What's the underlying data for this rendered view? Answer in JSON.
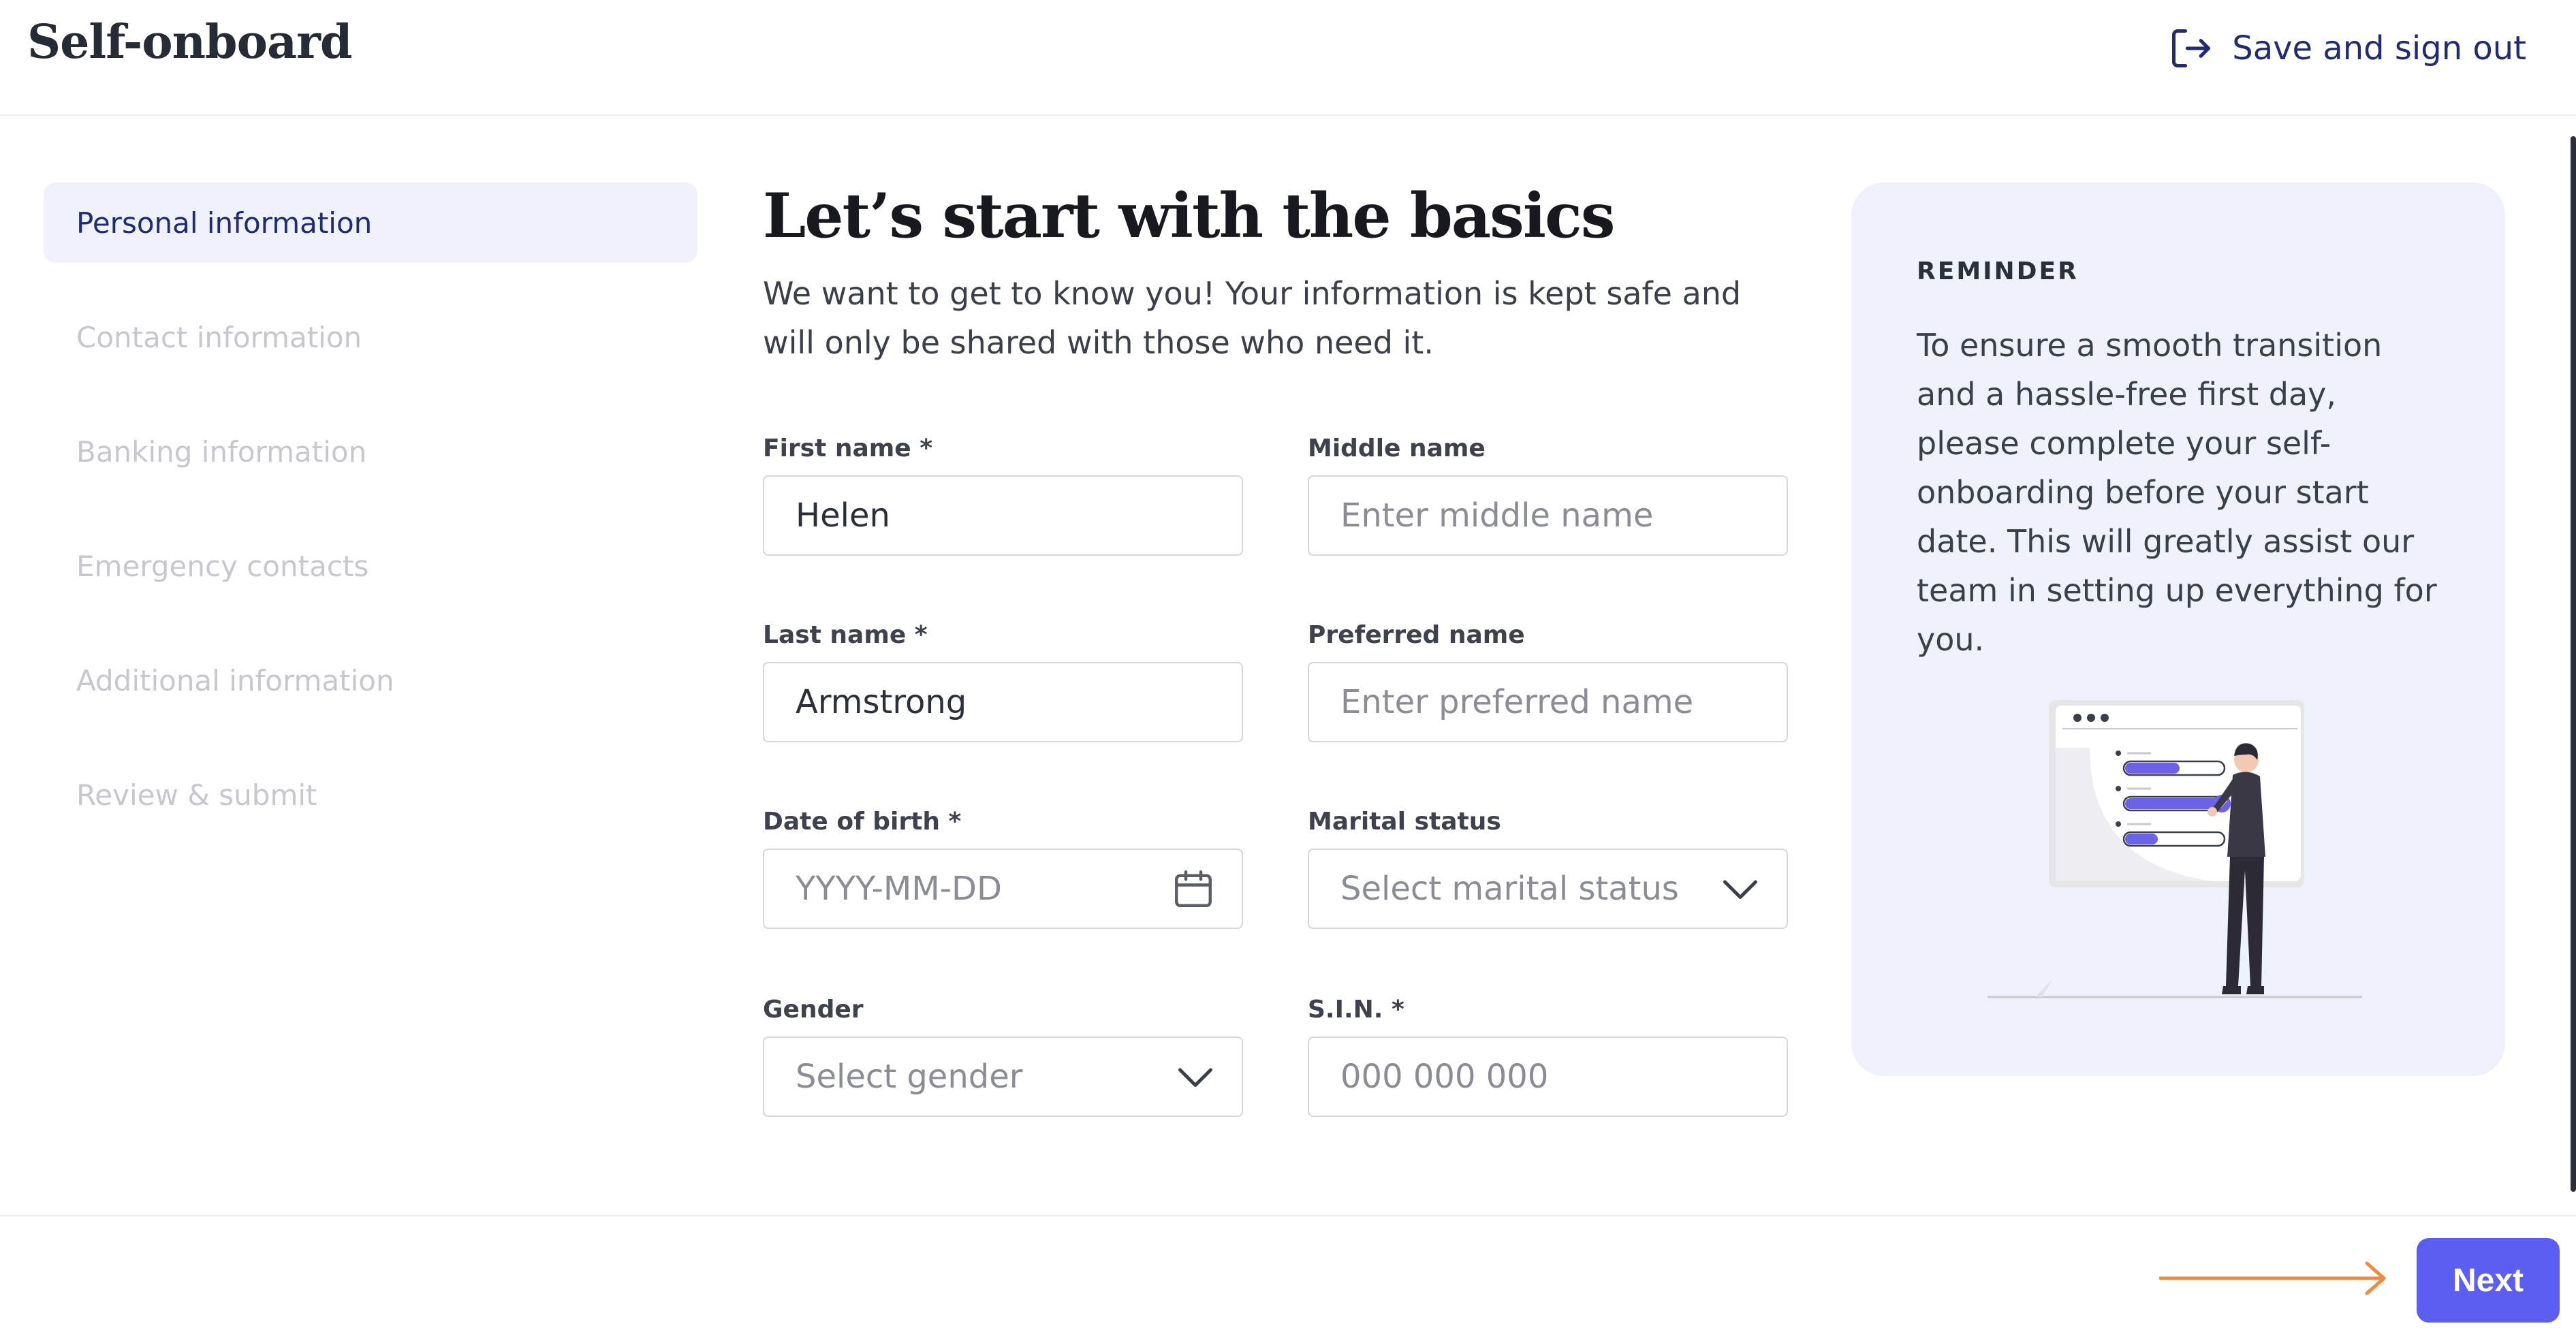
{
  "header": {
    "app_title": "Self-onboard",
    "signout_label": "Save and sign out",
    "signout_icon": "sign-out-icon"
  },
  "sidebar": {
    "items": [
      {
        "label": "Personal information",
        "active": true
      },
      {
        "label": "Contact information",
        "active": false
      },
      {
        "label": "Banking information",
        "active": false
      },
      {
        "label": "Emergency contacts",
        "active": false
      },
      {
        "label": "Additional information",
        "active": false
      },
      {
        "label": "Review & submit",
        "active": false
      }
    ]
  },
  "main": {
    "title": "Let’s start with the basics",
    "intro": "We want to get to know you! Your information is kept safe and will only be shared with those who need it.",
    "fields": {
      "first_name": {
        "label": "First name *",
        "value": "Helen",
        "placeholder": ""
      },
      "middle_name": {
        "label": "Middle name",
        "value": "",
        "placeholder": "Enter middle name"
      },
      "last_name": {
        "label": "Last name *",
        "value": "Armstrong",
        "placeholder": ""
      },
      "preferred_name": {
        "label": "Preferred name",
        "value": "",
        "placeholder": "Enter preferred name"
      },
      "dob": {
        "label": "Date of birth *",
        "value": "",
        "placeholder": "YYYY-MM-DD",
        "icon": "calendar-icon"
      },
      "marital": {
        "label": "Marital status",
        "value": "",
        "placeholder": "Select marital status",
        "icon": "chevron-down-icon"
      },
      "gender": {
        "label": "Gender",
        "value": "",
        "placeholder": "Select gender",
        "icon": "chevron-down-icon"
      },
      "sin": {
        "label": "S.I.N. *",
        "value": "",
        "placeholder": "000 000 000"
      }
    }
  },
  "reminder": {
    "heading": "REMINDER",
    "body": "To ensure a smooth transition and a hassle-free first day, please complete your self-onboarding before your start date. This will greatly assist our team in setting up everything for you."
  },
  "footer": {
    "next_label": "Next"
  },
  "colors": {
    "accent": "#5b5ef0",
    "nav_active_bg": "#eff2fd",
    "nav_active_text": "#1f2b72",
    "arrow": "#f08a3c"
  }
}
